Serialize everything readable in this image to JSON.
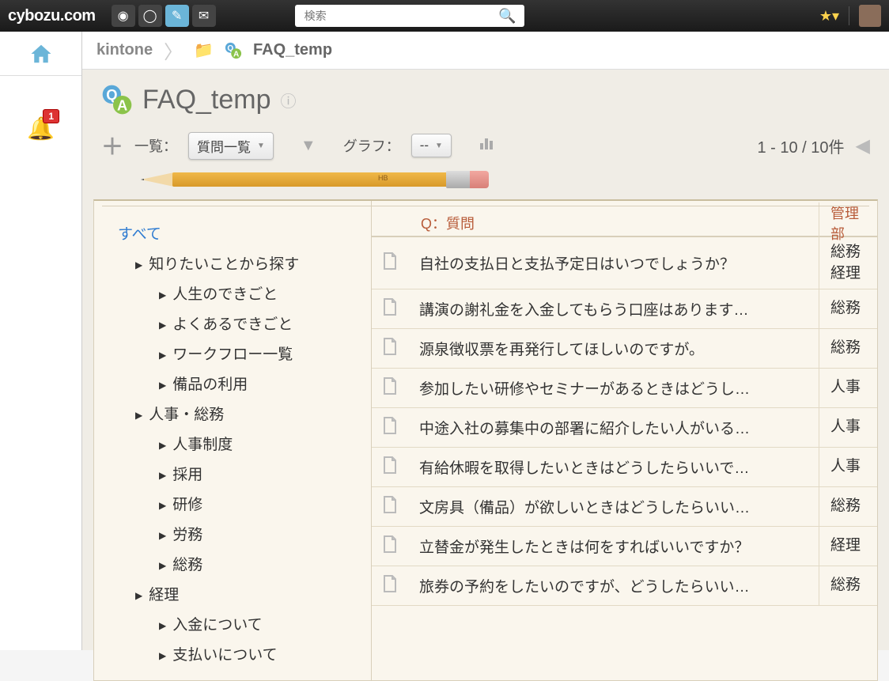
{
  "topbar": {
    "logo": "cybozu.com",
    "search_placeholder": "検索",
    "notification_count": "1"
  },
  "breadcrumb": {
    "root": "kintone",
    "current": "FAQ_temp"
  },
  "app": {
    "title": "FAQ_temp"
  },
  "toolbar": {
    "list_label": "一覧：",
    "list_value": "質問一覧",
    "graph_label": "グラフ：",
    "graph_value": "--",
    "pager_text": "1 - 10 / 10件"
  },
  "pencil_label": "HB",
  "tree": {
    "all": "すべて",
    "nodes": [
      {
        "label": "知りたいことから探す",
        "level": 1
      },
      {
        "label": "人生のできごと",
        "level": 2
      },
      {
        "label": "よくあるできごと",
        "level": 2
      },
      {
        "label": "ワークフロー一覧",
        "level": 2
      },
      {
        "label": "備品の利用",
        "level": 2
      },
      {
        "label": "人事・総務",
        "level": 1
      },
      {
        "label": "人事制度",
        "level": 2
      },
      {
        "label": "採用",
        "level": 2
      },
      {
        "label": "研修",
        "level": 2
      },
      {
        "label": "労務",
        "level": 2
      },
      {
        "label": "総務",
        "level": 2
      },
      {
        "label": "経理",
        "level": 1
      },
      {
        "label": "入金について",
        "level": 2
      },
      {
        "label": "支払いについて",
        "level": 2
      }
    ]
  },
  "table": {
    "headers": {
      "question": "Q：質問",
      "dept": "管理部"
    },
    "rows": [
      {
        "q": "自社の支払日と支払予定日はいつでしょうか？",
        "dept": "総務\n経理",
        "tall": true
      },
      {
        "q": "講演の謝礼金を入金してもらう口座はあります…",
        "dept": "総務"
      },
      {
        "q": "源泉徴収票を再発行してほしいのですが。",
        "dept": "総務"
      },
      {
        "q": "参加したい研修やセミナーがあるときはどうし…",
        "dept": "人事"
      },
      {
        "q": "中途入社の募集中の部署に紹介したい人がいる…",
        "dept": "人事"
      },
      {
        "q": "有給休暇を取得したいときはどうしたらいいで…",
        "dept": "人事"
      },
      {
        "q": "文房具（備品）が欲しいときはどうしたらいい…",
        "dept": "総務"
      },
      {
        "q": "立替金が発生したときは何をすればいいですか？",
        "dept": "経理"
      },
      {
        "q": "旅券の予約をしたいのですが、どうしたらいい…",
        "dept": "総務"
      }
    ]
  }
}
